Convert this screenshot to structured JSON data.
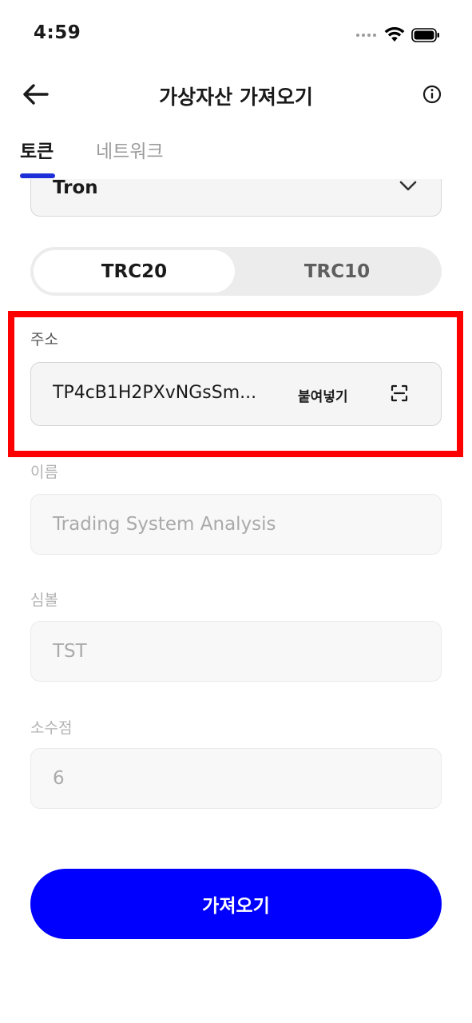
{
  "status_bar": {
    "time": "4:59",
    "icons": [
      "signal-dots-icon",
      "wifi-icon",
      "battery-icon"
    ]
  },
  "nav": {
    "title": "가상자산 가져오기",
    "back_icon": "arrow-left-icon",
    "info_icon": "info-circle-icon"
  },
  "tabs": [
    {
      "label": "토큰",
      "active": true
    },
    {
      "label": "네트워크",
      "active": false
    }
  ],
  "network_select": {
    "value": "Tron",
    "icon": "chevron-down-icon"
  },
  "token_standard": {
    "options": [
      "TRC20",
      "TRC10"
    ],
    "selected": "TRC20"
  },
  "fields": {
    "address": {
      "label": "주소",
      "value": "TP4cB1H2PXvNGsSm...",
      "paste_label": "붙여넣기",
      "scan_icon": "scan-icon"
    },
    "name": {
      "label": "이름",
      "value": "Trading System Analysis"
    },
    "symbol": {
      "label": "심볼",
      "value": "TST"
    },
    "decimals": {
      "label": "소수점",
      "value": "6"
    }
  },
  "submit_label": "가져오기",
  "colors": {
    "accent": "#0000ff",
    "tab_indicator": "#1d2fd8",
    "highlight": "#ff0000",
    "field_bg": "#f5f5f5",
    "disabled_text": "#aaaaaa"
  }
}
